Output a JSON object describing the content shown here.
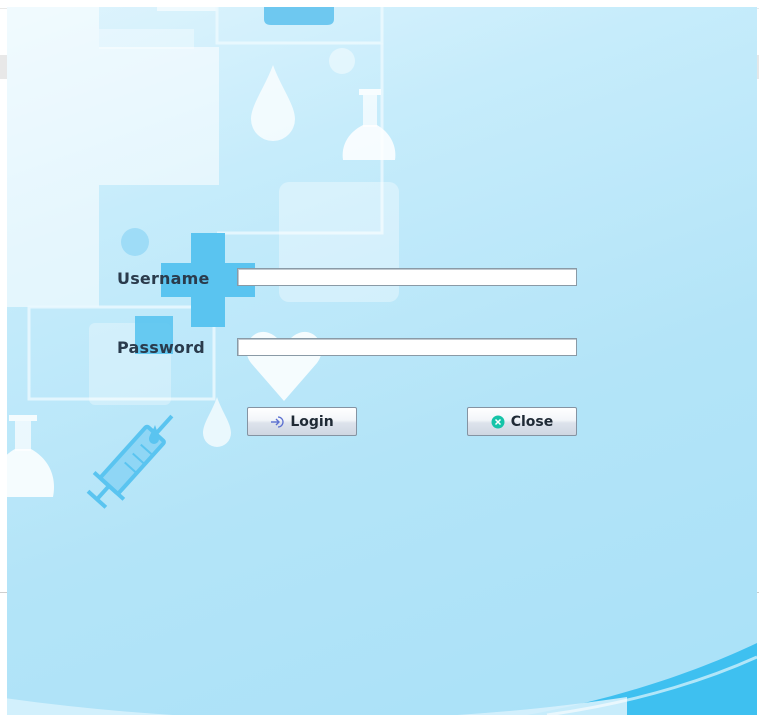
{
  "form": {
    "username_label": "Username",
    "password_label": "Password",
    "username_value": "",
    "password_value": ""
  },
  "buttons": {
    "login_label": "Login",
    "close_label": "Close"
  },
  "colors": {
    "background": "#b3e4f8",
    "accent": "#5ac4f0",
    "close_icon": "#16c4a8",
    "login_icon": "#5a6fd0"
  },
  "icons": {
    "login": "login-arrow-icon",
    "close": "close-circle-icon"
  }
}
